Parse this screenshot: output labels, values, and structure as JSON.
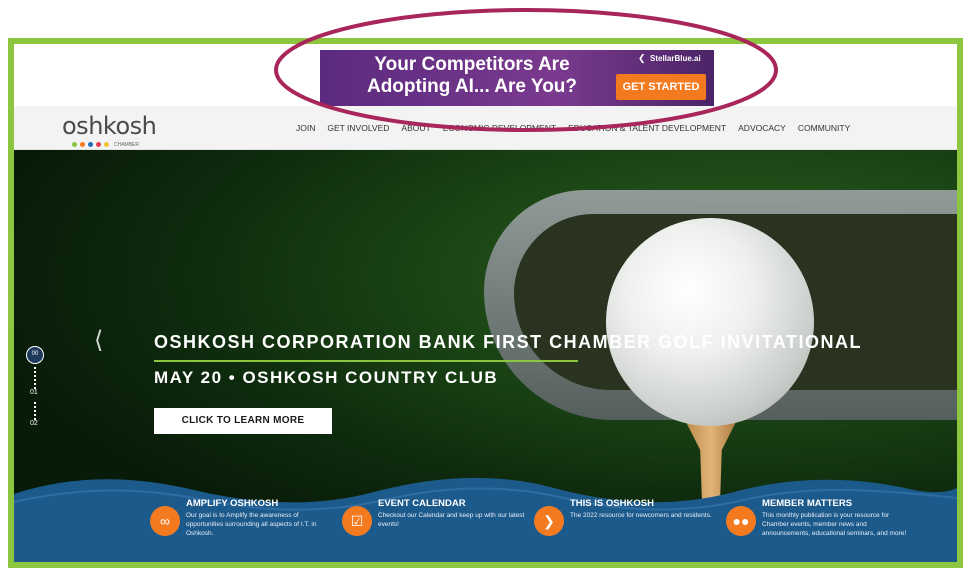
{
  "ad": {
    "headline": "Your Competitors Are Adopting AI... Are You?",
    "cta": "GET STARTED",
    "brand": "StellarBlue.ai"
  },
  "logo": {
    "text": "oshkosh",
    "sub": "CHAMBER",
    "dot_colors": [
      "#8cc63f",
      "#f47a20",
      "#1d6fb8",
      "#e43d4f",
      "#f2c12e"
    ]
  },
  "nav": {
    "items": [
      "JOIN",
      "GET INVOLVED",
      "ABOUT",
      "ECONOMIC DEVELOPMENT",
      "EDUCATION & TALENT DEVELOPMENT",
      "ADVOCACY",
      "COMMUNITY"
    ]
  },
  "hero": {
    "title": "OSHKOSH CORPORATION BANK FIRST CHAMBER GOLF INVITATIONAL",
    "subtitle": "MAY 20 • OSHKOSH COUNTRY CLUB",
    "cta": "CLICK TO LEARN MORE"
  },
  "pager": {
    "current": "00",
    "items": [
      "01",
      "02"
    ]
  },
  "features": [
    {
      "title": "AMPLIFY OSHKOSH",
      "desc": "Our goal is to Amplify the awareness of opportunities surrounding all aspects of I.T. in Oshkosh.",
      "icon": "amplify-icon"
    },
    {
      "title": "EVENT CALENDAR",
      "desc": "Checkout our Calendar and keep up with our latest events!",
      "icon": "checkbox-icon"
    },
    {
      "title": "THIS IS OSHKOSH",
      "desc": "The 2022 resource for newcomers and residents.",
      "icon": "play-arrow-icon"
    },
    {
      "title": "MEMBER MATTERS",
      "desc": "This monthly publication is your resource for Chamber events, member news and announcements, educational seminars, and more!",
      "icon": "people-icon"
    }
  ],
  "colors": {
    "border_green": "#8cc63f",
    "accent_orange": "#f47a20",
    "band_blue": "#1d5a8c",
    "annotation": "#a8265a"
  }
}
